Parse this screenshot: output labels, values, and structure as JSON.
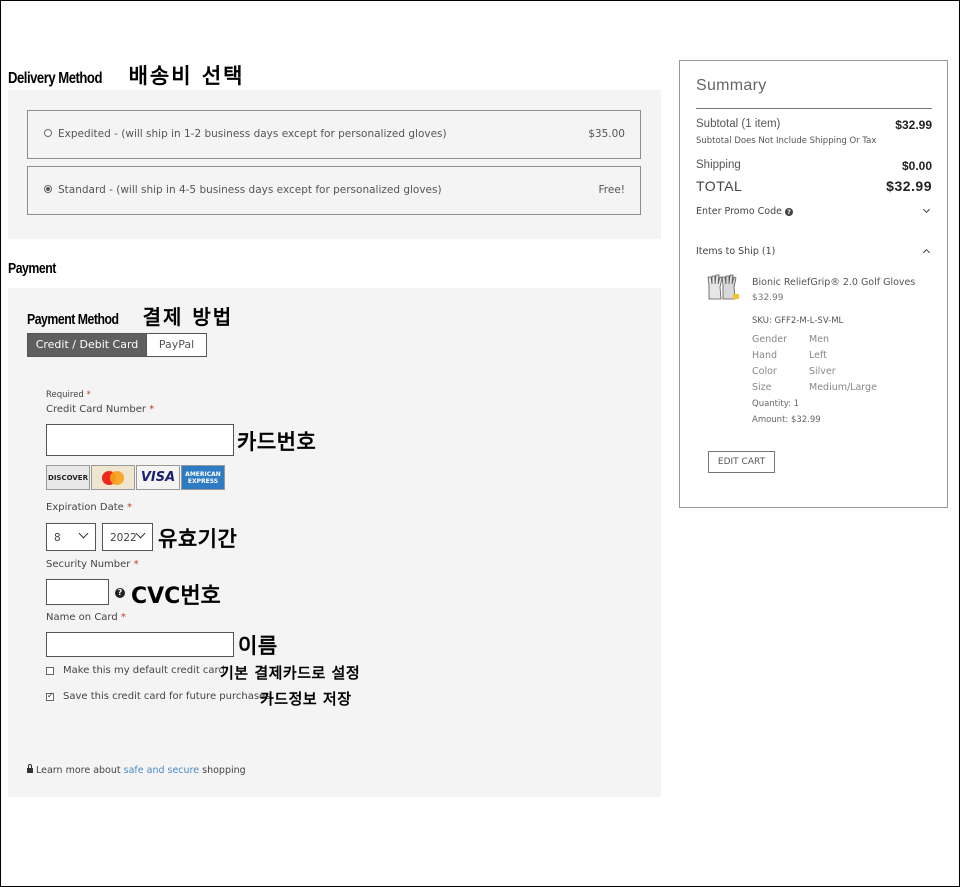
{
  "delivery": {
    "title": "Delivery Method",
    "title_ko": "배송비 선택",
    "options": [
      {
        "label": "Expedited - (will ship in 1-2 business days except for personalized gloves)",
        "price": "$35.00",
        "selected": false
      },
      {
        "label": "Standard - (will ship in 4-5 business days except for personalized gloves)",
        "price": "Free!",
        "selected": true
      }
    ]
  },
  "payment": {
    "title": "Payment",
    "method_title": "Payment Method",
    "method_title_ko": "결제 방법",
    "tabs": [
      "Credit / Debit Card",
      "PayPal"
    ],
    "required_label": "Required",
    "required_mark": "*",
    "card_number_label": "Credit Card Number",
    "card_number_ko": "카드번호",
    "card_brands": [
      "DISCOVER",
      "MasterCard",
      "VISA",
      "AMERICAN EXPRESS"
    ],
    "expiration_label": "Expiration Date",
    "expiration_month": "8",
    "expiration_year": "2022",
    "expiration_ko": "유효기간",
    "security_label": "Security Number",
    "security_ko": "CVC번호",
    "name_label": "Name on Card",
    "name_ko": "이름",
    "default_card_label": "Make this my default credit card",
    "default_card_ko": "기본 결제카드로 설정",
    "default_card_checked": false,
    "save_card_label": "Save this credit card for future purchases",
    "save_card_ko": "카드정보 저장",
    "save_card_checked": true,
    "learn_prefix": "Learn more about",
    "learn_link": "safe and secure",
    "learn_suffix": "shopping"
  },
  "summary": {
    "title": "Summary",
    "subtotal_label": "Subtotal",
    "subtotal_count": "(1 item)",
    "subtotal_value": "$32.99",
    "subtotal_note": "Subtotal Does Not Include Shipping Or Tax",
    "shipping_label": "Shipping",
    "shipping_value": "$0.00",
    "total_label": "TOTAL",
    "total_value": "$32.99",
    "promo_label": "Enter Promo Code",
    "items_label": "Items to Ship (1)",
    "product": {
      "name": "Bionic ReliefGrip® 2.0 Golf Gloves",
      "price": "$32.99",
      "sku": "SKU: GFF2-M-L-SV-ML",
      "attributes": [
        {
          "k": "Gender",
          "v": "Men"
        },
        {
          "k": "Hand",
          "v": "Left"
        },
        {
          "k": "Color",
          "v": "Silver"
        },
        {
          "k": "Size",
          "v": "Medium/Large"
        }
      ],
      "quantity": "Quantity: 1",
      "amount": "Amount: $32.99"
    },
    "edit_cart": "EDIT CART"
  },
  "colors": {
    "panel_bg": "#f4f4f4",
    "active_tab": "#5f5f5f",
    "link": "#4a8bc2",
    "required": "#c0392b"
  }
}
